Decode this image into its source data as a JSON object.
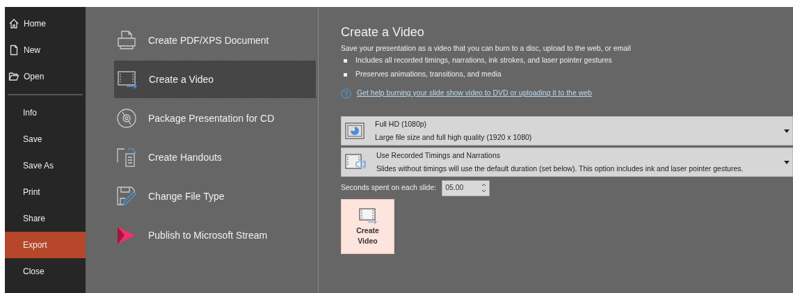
{
  "nav_top": [
    {
      "label": "Home"
    },
    {
      "label": "New"
    },
    {
      "label": "Open"
    }
  ],
  "nav_bottom": [
    {
      "label": "Info",
      "selected": false
    },
    {
      "label": "Save",
      "selected": false
    },
    {
      "label": "Save As",
      "selected": false
    },
    {
      "label": "Print",
      "selected": false
    },
    {
      "label": "Share",
      "selected": false
    },
    {
      "label": "Export",
      "selected": true
    },
    {
      "label": "Close",
      "selected": false
    }
  ],
  "export_options": [
    {
      "label": "Create PDF/XPS Document",
      "selected": false
    },
    {
      "label": "Create a Video",
      "selected": true
    },
    {
      "label": "Package Presentation for CD",
      "selected": false
    },
    {
      "label": "Create Handouts",
      "selected": false
    },
    {
      "label": "Change File Type",
      "selected": false
    },
    {
      "label": "Publish to Microsoft Stream",
      "selected": false
    }
  ],
  "detail": {
    "title": "Create a Video",
    "description": "Save your presentation as a video that you can burn to a disc, upload to the web, or email",
    "bullets": [
      "Includes all recorded timings, narrations, ink strokes, and laser pointer gestures",
      "Preserves animations, transitions, and media"
    ],
    "help_link": "Get help burning your slide show video to DVD or uploading it to the web",
    "dropdowns": [
      {
        "title": "Full HD (1080p)",
        "subtitle": "Large file size and full high quality (1920 x 1080)"
      },
      {
        "title": "Use Recorded Timings and Narrations",
        "subtitle": "Slides without timings will use the default duration (set below). This option includes ink and laser pointer gestures."
      }
    ],
    "seconds_label": "Seconds spent on each slide:",
    "seconds_value": "05.00",
    "create_button": "Create Video"
  }
}
